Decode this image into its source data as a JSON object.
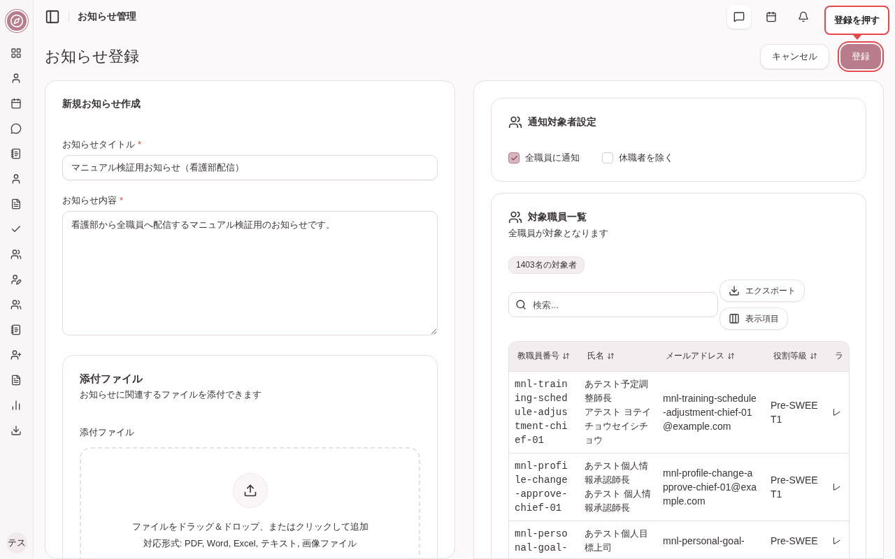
{
  "header": {
    "title": "お知らせ管理"
  },
  "sidebar": {
    "avatar": "テス"
  },
  "tooltip": {
    "text": "登録を押す"
  },
  "page": {
    "title": "お知らせ登録"
  },
  "actions": [
    {
      "label": "キャンセル",
      "kind": "secondary",
      "highlighted": false
    },
    {
      "label": "登録",
      "kind": "primary",
      "highlighted": true
    }
  ],
  "form": {
    "title": "新規お知らせ作成",
    "fields": [
      {
        "label": "お知らせタイトル",
        "required_mark": "*",
        "kind": "input",
        "value": "マニュアル検証用お知らせ（看護部配信）"
      },
      {
        "label": "お知らせ内容",
        "required_mark": "*",
        "kind": "textarea",
        "value": "看護部から全職員へ配信するマニュアル検証用のお知らせです。"
      }
    ],
    "attachments": {
      "title": "添付ファイル",
      "description": "お知らせに関連するファイルを添付できます",
      "label": "添付ファイル",
      "drop_text": "ファイルをドラッグ＆ドロップ、またはクリックして追加",
      "formats": "対応形式: PDF, Word, Excel, テキスト, 画像ファイル"
    }
  },
  "recipients": {
    "title": "通知対象者設定",
    "options": [
      {
        "label": "全職員に通知",
        "checked": true
      },
      {
        "label": "休職者を除く",
        "checked": false
      }
    ]
  },
  "staff": {
    "title": "対象職員一覧",
    "subtitle": "全職員が対象となります",
    "count": "1403名の対象者",
    "search": {
      "placeholder": "検索..."
    },
    "buttons": [
      {
        "label": "エクスポート",
        "kind": "export"
      },
      {
        "label": "表示項目",
        "kind": "columns"
      }
    ],
    "columns": [
      {
        "label": "教職員番号",
        "sortable": true
      },
      {
        "label": "氏名",
        "sortable": true
      },
      {
        "label": "メールアドレス",
        "sortable": true
      },
      {
        "label": "役割等級",
        "sortable": true
      },
      {
        "label": "ラ",
        "sortable": false
      }
    ],
    "rows": [
      [
        "mnl-training-schedule-adjustment-chief-01",
        [
          "あテスト予定調整師長",
          "アテスト ヨテイチョウセイシチョウ"
        ],
        "mnl-training-schedule-adjustment-chief-01@example.com",
        "Pre-SWEET1",
        "レ"
      ],
      [
        "mnl-profile-change-approve-chief-01",
        [
          "あテスト個人情報承認師長",
          "あテスト 個人情報承認師長"
        ],
        "mnl-profile-change-approve-chief-01@example.com",
        "Pre-SWEET1",
        "レ"
      ],
      [
        "mnl-personal-goal-",
        [
          "あテスト個人目標上司"
        ],
        "mnl-personal-goal-",
        "Pre-SWEE",
        "レ"
      ]
    ]
  }
}
